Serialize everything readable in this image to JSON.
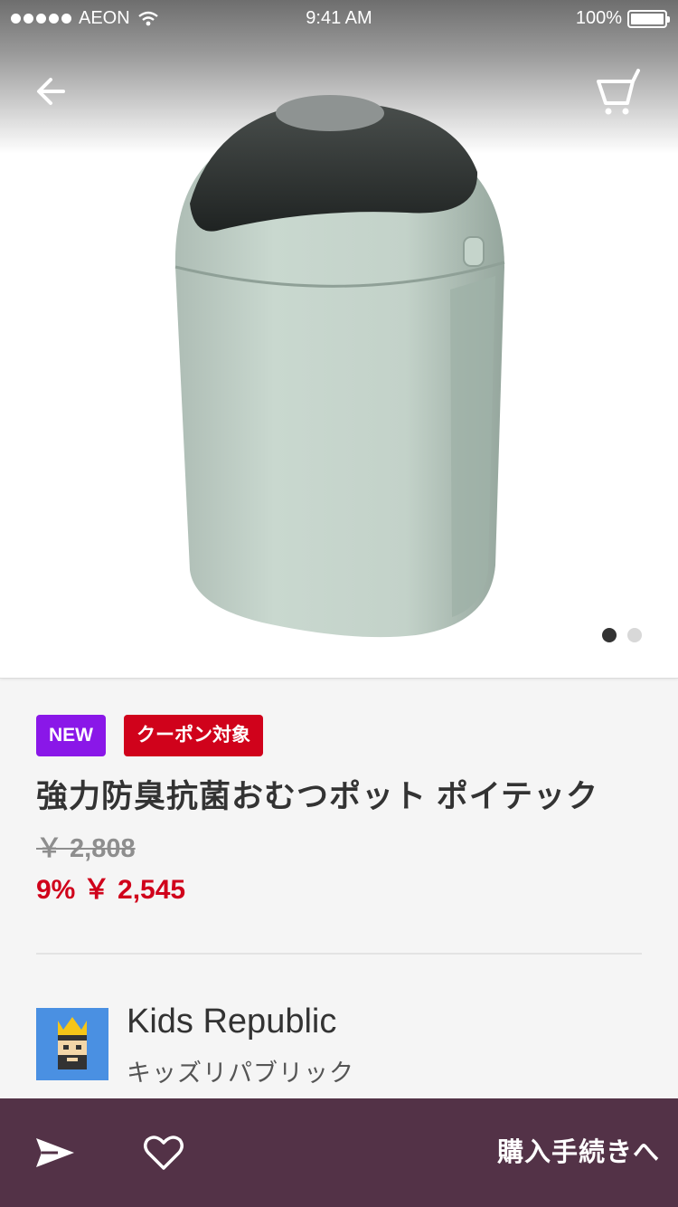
{
  "status_bar": {
    "carrier": "AEON",
    "time": "9:41 AM",
    "battery": "100%"
  },
  "nav": {
    "back_icon": "arrow-left-icon",
    "cart_icon": "cart-icon"
  },
  "carousel": {
    "current": 1,
    "total": 2
  },
  "badges": {
    "new": "NEW",
    "coupon": "クーポン対象"
  },
  "product": {
    "title": "強力防臭抗菌おむつポット ポイテック",
    "old_price": "￥ 2,808",
    "discount_price": "9% ￥ 2,545"
  },
  "shop": {
    "name": "Kids Republic",
    "kana": "キッズリパブリック"
  },
  "bottom_bar": {
    "checkout_label": "購入手続きへ"
  },
  "colors": {
    "accent_purple": "#8a17e8",
    "sale_red": "#d0021b",
    "bar_plum": "#533247"
  }
}
